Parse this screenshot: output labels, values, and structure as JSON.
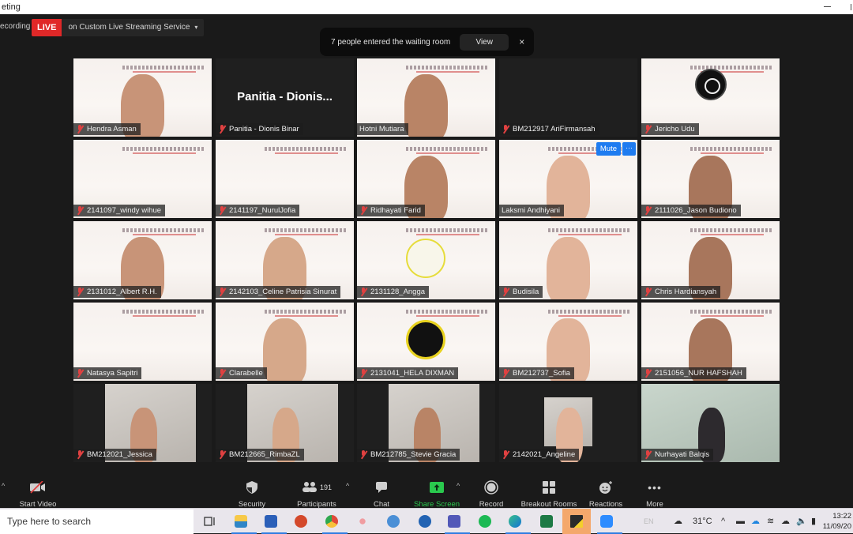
{
  "window": {
    "title": "eting"
  },
  "header": {
    "recording_label": "ecording",
    "live_badge": "LIVE",
    "live_service": "on Custom Live Streaming Service",
    "live_service_caret": "▾"
  },
  "notification": {
    "text": "7 people entered the waiting room",
    "view_label": "View",
    "close_glyph": "×"
  },
  "tiles": [
    {
      "name": "Hendra Asman",
      "muted": true,
      "video": "slide-person"
    },
    {
      "name": "Panitia - Dionis Binar",
      "muted": true,
      "video": "off",
      "display_name": "Panitia - Dionis..."
    },
    {
      "name": "Hotni Mutiara",
      "muted": false,
      "video": "slide-person",
      "active_speaker": true
    },
    {
      "name": "BM212917 AriFirmansah",
      "muted": true,
      "video": "off"
    },
    {
      "name": "Jericho Udu",
      "muted": true,
      "video": "slide-logo"
    },
    {
      "name": "2141097_windy wihue",
      "muted": true,
      "video": "slide"
    },
    {
      "name": "2141197_NurulJofia",
      "muted": true,
      "video": "slide"
    },
    {
      "name": "Ridhayati Farid",
      "muted": true,
      "video": "slide-person"
    },
    {
      "name": "Laksmi Andhiyani",
      "muted": false,
      "video": "slide-person",
      "hover_actions": {
        "mute_label": "Mute",
        "more_label": "···"
      }
    },
    {
      "name": "2111026_Jason Budiono",
      "muted": true,
      "video": "slide-person"
    },
    {
      "name": "2131012_Albert R.H.",
      "muted": true,
      "video": "slide-person"
    },
    {
      "name": "2142103_Celine Patrisia Sinurat",
      "muted": true,
      "video": "slide-person"
    },
    {
      "name": "2131128_Angga",
      "muted": true,
      "video": "slide-logo"
    },
    {
      "name": "Budisila",
      "muted": true,
      "video": "slide-person"
    },
    {
      "name": "Chris Hardiansyah",
      "muted": true,
      "video": "slide-person"
    },
    {
      "name": "Natasya Sapitri",
      "muted": true,
      "video": "slide"
    },
    {
      "name": "Clarabelle",
      "muted": true,
      "video": "slide-person"
    },
    {
      "name": "2131041_HELA DIXMAN",
      "muted": true,
      "video": "slide-logo"
    },
    {
      "name": "BM212737_Sofia",
      "muted": true,
      "video": "slide-person"
    },
    {
      "name": "2151056_NUR HAFSHAH",
      "muted": true,
      "video": "slide-person"
    },
    {
      "name": "BM212021_Jessica",
      "muted": true,
      "video": "photo"
    },
    {
      "name": "BM212665_RimbaZL",
      "muted": true,
      "video": "photo"
    },
    {
      "name": "BM212785_Stevie Gracia",
      "muted": true,
      "video": "photo"
    },
    {
      "name": "2142021_Angeline",
      "muted": true,
      "video": "photo"
    },
    {
      "name": "Nurhayati Balqis",
      "muted": true,
      "video": "photo"
    }
  ],
  "toolbar": {
    "start_video": "Start Video",
    "security": "Security",
    "participants": "Participants",
    "participants_count": "191",
    "chat": "Chat",
    "share_screen": "Share Screen",
    "record": "Record",
    "breakout_rooms": "Breakout Rooms",
    "reactions": "Reactions",
    "more": "More",
    "caret": "^"
  },
  "taskbar": {
    "search_placeholder": "Type here to search",
    "apps": [
      "task-view",
      "file-explorer",
      "word",
      "powerpoint",
      "chrome",
      "snipping-tool",
      "app-globe",
      "app-pls",
      "teams",
      "spotify",
      "edge",
      "excel",
      "sticky-notes",
      "zoom"
    ],
    "lang": "EN",
    "weather": "31°C",
    "time": "13:22",
    "date": "11/09/20"
  },
  "colors": {
    "live_red": "#e02828",
    "share_green": "#2ac94e",
    "active_speaker": "#c8e25a",
    "mute_blue": "#1f7cf0"
  }
}
